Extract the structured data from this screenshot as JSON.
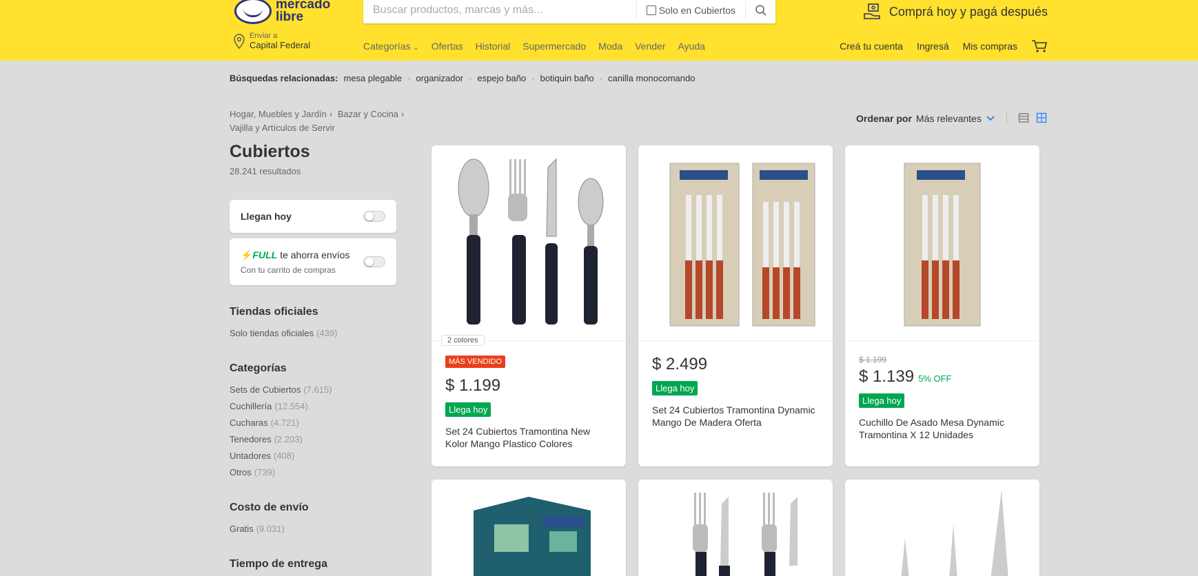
{
  "header": {
    "logo_text_line1": "mercado",
    "logo_text_line2": "libre",
    "search_placeholder": "Buscar productos, marcas y más...",
    "search_filter_label": "Solo en Cubiertos",
    "promo_text": "Comprá hoy y pagá después",
    "location_small": "Enviar a",
    "location_city": "Capital Federal",
    "nav": [
      "Categorías",
      "Ofertas",
      "Historial",
      "Supermercado",
      "Moda",
      "Vender",
      "Ayuda"
    ],
    "user_nav": [
      "Creá tu cuenta",
      "Ingresá",
      "Mis compras"
    ]
  },
  "related": {
    "label": "Búsquedas relacionadas:",
    "items": [
      "mesa plegable",
      "organizador",
      "espejo baño",
      "botiquin baño",
      "canilla monocomando"
    ]
  },
  "breadcrumb": [
    "Hogar, Muebles y Jardín",
    "Bazar y Cocina",
    "Vajilla y Artículos de Servir"
  ],
  "sort": {
    "label": "Ordenar por",
    "value": "Más relevantes"
  },
  "sidebar": {
    "title": "Cubiertos",
    "results": "28.241 resultados",
    "card1_label": "Llegan hoy",
    "card2_tag": "FULL",
    "card2_label": "te ahorra envíos",
    "card2_sub": "Con tu carrito de compras",
    "sections": [
      {
        "head": "Tiendas oficiales",
        "items": [
          {
            "label": "Solo tiendas oficiales",
            "count": "(439)"
          }
        ]
      },
      {
        "head": "Categorías",
        "items": [
          {
            "label": "Sets de Cubiertos",
            "count": "(7.615)"
          },
          {
            "label": "Cuchillería",
            "count": "(12.554)"
          },
          {
            "label": "Cucharas",
            "count": "(4.721)"
          },
          {
            "label": "Tenedores",
            "count": "(2.203)"
          },
          {
            "label": "Untadores",
            "count": "(408)"
          },
          {
            "label": "Otros",
            "count": "(739)"
          }
        ]
      },
      {
        "head": "Costo de envío",
        "items": [
          {
            "label": "Gratis",
            "count": "(9.031)"
          }
        ]
      },
      {
        "head": "Tiempo de entrega",
        "items": []
      }
    ]
  },
  "products": [
    {
      "colors": "2 colores",
      "badge": "MÁS VENDIDO",
      "price": "$ 1.199",
      "shipping": "Llega hoy",
      "title": "Set 24 Cubiertos Tramontina New Kolor Mango Plastico Colores"
    },
    {
      "price": "$ 2.499",
      "shipping": "Llega hoy",
      "title": "Set 24 Cubiertos Tramontina Dynamic Mango De Madera Oferta"
    },
    {
      "price_old": "$ 1.199",
      "price": "$ 1.139",
      "discount": "5% OFF",
      "shipping": "Llega hoy",
      "title": "Cuchillo De Asado Mesa Dynamic Tramontina X 12 Unidades"
    }
  ],
  "colors": {
    "header_bg": "#ffe12e",
    "brand_blue": "#2d3277",
    "green": "#00a650",
    "badge_red": "#e8401c",
    "link_blue": "#3483fa"
  }
}
